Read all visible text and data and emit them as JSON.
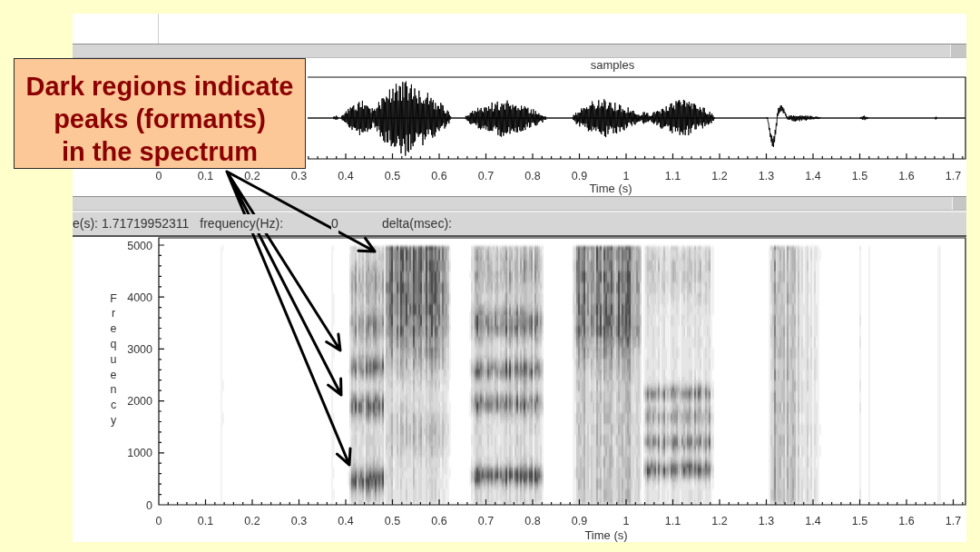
{
  "callout": {
    "lines": [
      "Dark regions indicate",
      "peaks (formants)",
      "in the spectrum"
    ]
  },
  "waveform": {
    "title": "samples",
    "x_ticks": [
      "0",
      "0.1",
      "0.2",
      "0.3",
      "0.4",
      "0.5",
      "0.6",
      "0.7",
      "0.8",
      "0.9",
      "1",
      "1.1",
      "1.2",
      "1.3",
      "1.4",
      "1.5",
      "1.6",
      "1.7"
    ],
    "xlabel": "Time (s)"
  },
  "status_bar": [
    {
      "label": "e(s):",
      "value": "1.71719952311"
    },
    {
      "label": "frequency(Hz):",
      "value": "0"
    },
    {
      "label": "delta(msec):"
    }
  ],
  "spectrogram": {
    "ylabel": "Frequency",
    "y_ticks": [
      "5000",
      "4000",
      "3000",
      "2000",
      "1000",
      "0"
    ],
    "x_ticks": [
      "0",
      "0.1",
      "0.2",
      "0.3",
      "0.4",
      "0.5",
      "0.6",
      "0.7",
      "0.8",
      "0.9",
      "1",
      "1.1",
      "1.2",
      "1.3",
      "1.4",
      "1.5",
      "1.6",
      "1.7"
    ],
    "xlabel": "Time (s)"
  }
}
